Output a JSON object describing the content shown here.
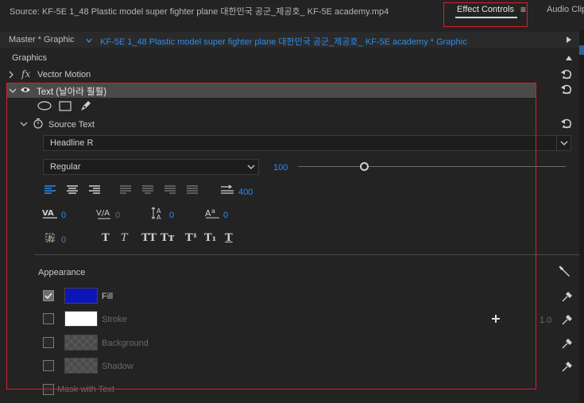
{
  "tabs": {
    "source": "Source: KF-5E  1_48 Plastic model  super fighter plane 대한민국 공군_제공호_ KF-5E academy.mp4",
    "effect_controls": "Effect Controls",
    "menu_glyph": "≡",
    "audio": "Audio Clip"
  },
  "header": {
    "master": "Master * Graphic",
    "clip": "KF-5E  1_48 Plastic model  super fighter plane 대한민국 공군_제공호_ KF-5E academy * Graphic"
  },
  "section": {
    "title": "Graphics"
  },
  "rows": {
    "fx": "fx",
    "vector_motion": "Vector Motion",
    "text_layer": "Text (날아라 훨훨)",
    "source_text": "Source Text"
  },
  "font": {
    "family": "Headline R",
    "style": "Regular",
    "size": "100"
  },
  "paragraph": {
    "tracking_right": "400"
  },
  "metrics": {
    "kerning": "0",
    "tracking": "0",
    "leading": "0",
    "baseline": "0",
    "tsume": "0"
  },
  "type_buttons": {
    "faux_bold": "T",
    "faux_italic": "T",
    "all_caps": "TT",
    "small_caps": "Tт",
    "superscript": "T¹",
    "subscript": "T₁",
    "underline": "T"
  },
  "appearance": {
    "title": "Appearance",
    "fill": "Fill",
    "stroke": "Stroke",
    "stroke_width": "1.0",
    "background": "Background",
    "shadow": "Shadow",
    "mask": "Mask with Text",
    "fill_color": "#0c16b8",
    "stroke_color": "#ffffff"
  },
  "colors": {
    "accent": "#2d8ceb",
    "highlight": "#d8202a"
  }
}
